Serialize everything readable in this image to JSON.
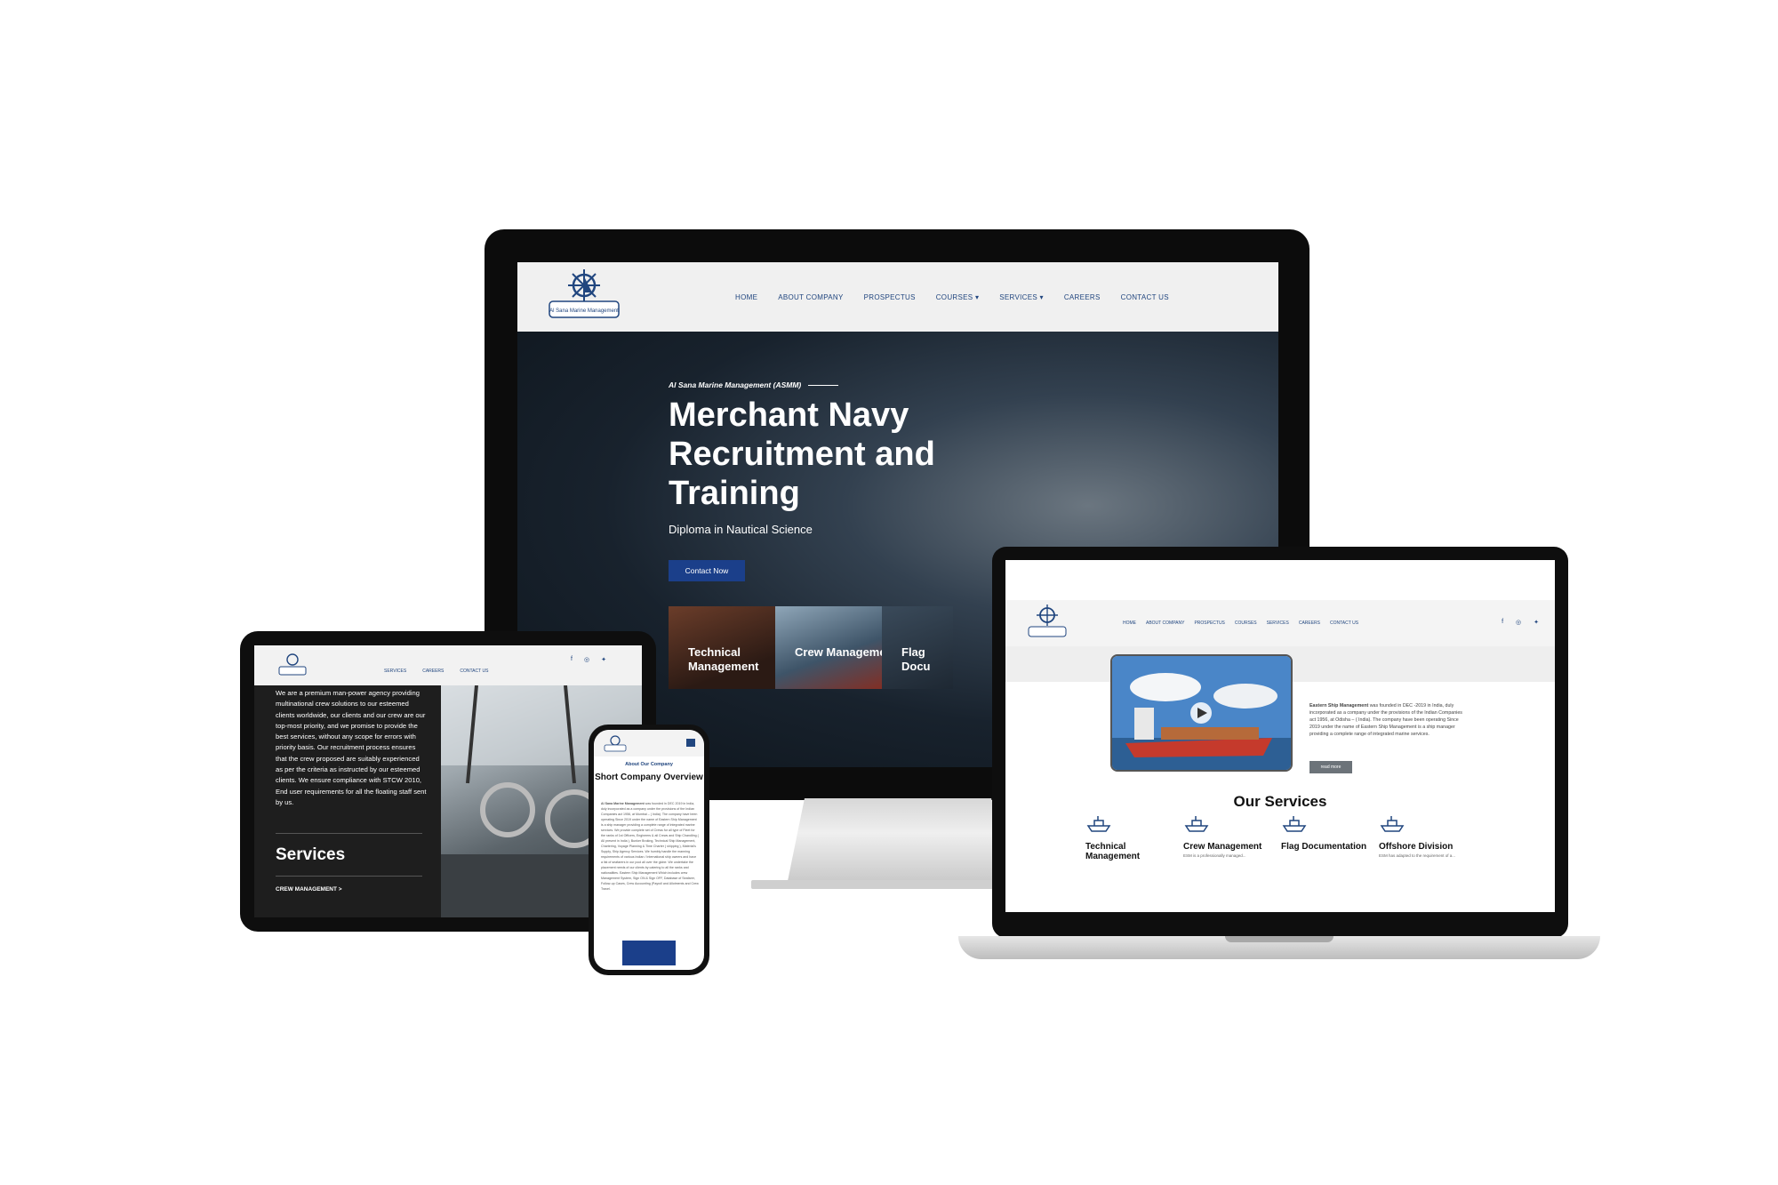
{
  "brand": {
    "name": "Al Sana Marine Management",
    "navy": "#21467f",
    "button_blue": "#1b3f8a"
  },
  "monitor": {
    "nav": [
      "HOME",
      "ABOUT COMPANY",
      "PROSPECTUS",
      "COURSES",
      "SERVICES",
      "CAREERS",
      "CONTACT US"
    ],
    "hero": {
      "tagline": "Al Sana Marine Management (ASMM)",
      "title": "Merchant Navy Recruitment and Training",
      "subtitle": "Diploma in Nautical Science",
      "cta": "Contact Now"
    },
    "cards": [
      "Technical Management",
      "Crew Management",
      "Flag Docu"
    ]
  },
  "laptop": {
    "nav": [
      "HOME",
      "ABOUT COMPANY",
      "PROSPECTUS",
      "COURSES",
      "SERVICES",
      "CAREERS",
      "CONTACT US"
    ],
    "about_text_bold": "Eastern Ship Management",
    "about_text": "was founded in DEC -2019 in India, duly incorporated as a company under the provisions of the Indian Companies act 1956, at Odisha – ( India). The company have been operating Since 2019 under the name of Eastern Ship Management is a ship manager providing a complete range of integrated marine services.",
    "read_more": "read more",
    "services_heading": "Our Services",
    "services": [
      {
        "title": "Technical Management",
        "desc": ""
      },
      {
        "title": "Crew Management",
        "desc": "ESM is a professionally managed..."
      },
      {
        "title": "Flag Documentation",
        "desc": ""
      },
      {
        "title": "Offshore Division",
        "desc": "ESM has adapted to the requirement of a..."
      }
    ]
  },
  "tablet": {
    "nav": [
      "SERVICES",
      "CAREERS",
      "CONTACT US"
    ],
    "paragraph": "We are a premium man-power agency providing multinational crew solutions to our esteemed clients worldwide, our clients and our crew are our top-most priority, and we promise to provide the best services, without any scope for errors with priority basis. Our recruitment process ensures that the crew proposed are suitably experienced as per the criteria as instructed by our esteemed clients. We ensure compliance with STCW 2010, End user requirements for all the floating staff sent by us.",
    "services_heading": "Services",
    "crew_link": "CREW MANAGEMENT >"
  },
  "phone": {
    "about_label": "About Our Company",
    "title": "Short Company Overview",
    "body_bold": "Al Sana Marine Management",
    "body": "was founded in DEC 2019 in India, duly incorporated as a company under the provisions of the Indian Companies act 1956, at Mumbai – ( India). The company have been operating Since 2019 under the name of Eastern Ship Management is a ship manager providing a complete range of integrated marine services. We provide complete set of Crews for all type of Fleet for the ranks of 1st Officers, Engineers & all Crews and Ship Chandling ( All present in India ), Bunker Broking, Technical Ship Management, Chartering, Voyage Planning & Time Charter ( shipping ), Material's Supply, Ship Agency Services. We humbly handle the manning requirements of various Indian / International ship owners and have a list of seafarers in our pool all over the globe. We undertake the placement needs of our clients by catering to all the ranks and nationalities. Eastern Ship Management Which includes crew Management System, Sign ON & Sign OFF, Database of Seafarer, Follow-up Cases, Crew Accounting (Payroll and Allotments and Crew Travel."
  }
}
